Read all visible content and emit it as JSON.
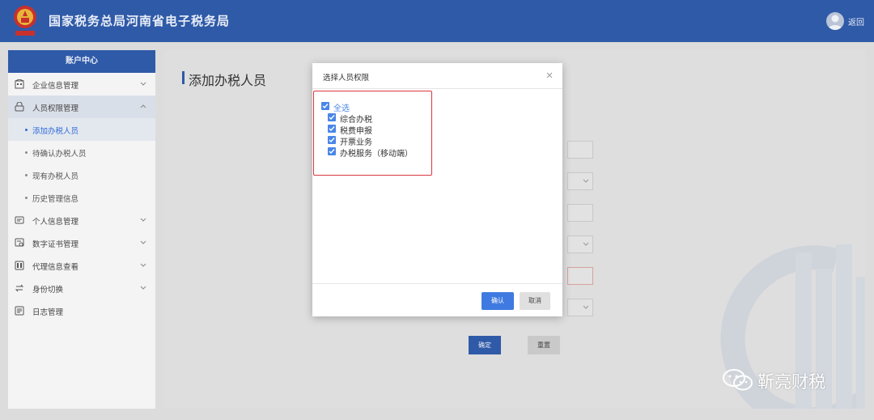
{
  "header": {
    "site_title": "国家税务总局河南省电子税务局",
    "return_label": "返回"
  },
  "sidebar": {
    "title": "账户中心",
    "items": [
      {
        "label": "企业信息管理",
        "icon": "building-icon"
      },
      {
        "label": "人员权限管理",
        "icon": "user-lock-icon"
      },
      {
        "label": "个人信息管理",
        "icon": "id-card-icon"
      },
      {
        "label": "数字证书管理",
        "icon": "certificate-icon"
      },
      {
        "label": "代理信息查看",
        "icon": "agent-icon"
      },
      {
        "label": "身份切换",
        "icon": "switch-icon"
      },
      {
        "label": "日志管理",
        "icon": "log-icon"
      }
    ],
    "sub_items": [
      {
        "label": "添加办税人员"
      },
      {
        "label": "待确认办税人员"
      },
      {
        "label": "现有办税人员"
      },
      {
        "label": "历史管理信息"
      }
    ]
  },
  "main": {
    "page_title": "添加办税人员",
    "confirm_label": "确定",
    "reset_label": "重置"
  },
  "modal": {
    "title": "选择人员权限",
    "select_all": "全选",
    "options": [
      {
        "label": "综合办税",
        "checked": true
      },
      {
        "label": "税费申报",
        "checked": true
      },
      {
        "label": "开票业务",
        "checked": true
      },
      {
        "label": "办税服务（移动端）",
        "checked": true
      }
    ],
    "ok_label": "确认",
    "cancel_label": "取消"
  },
  "watermark_text": "靳亮财税",
  "colors": {
    "header": "#2f5aa8",
    "checkbox": "#4a86e8",
    "highlight": "#d9363e"
  }
}
